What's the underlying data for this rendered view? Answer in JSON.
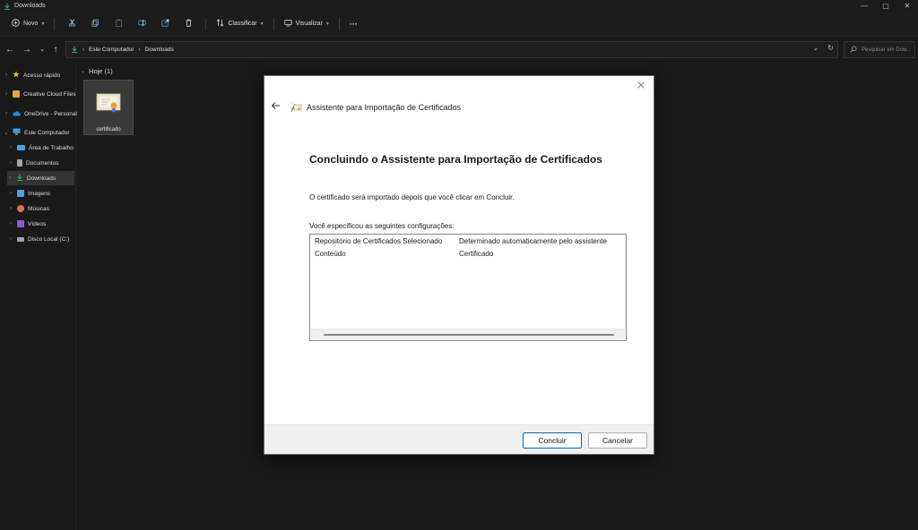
{
  "window": {
    "title": "Downloads",
    "controls": [
      "—",
      "▢",
      "✕"
    ]
  },
  "toolbar": {
    "new_label": "Novo",
    "sort_label": "Classificar",
    "view_label": "Visualizar",
    "more_label": "···"
  },
  "address": {
    "crumbs": [
      "Este Computador",
      "Downloads"
    ],
    "search_placeholder": "Pesquisar em Dow..."
  },
  "sidebar": {
    "items": [
      {
        "label": "Acesso rápido",
        "icon": "star-icon",
        "color": "#f5c518"
      },
      {
        "label": "Creative Cloud Files",
        "icon": "creative-cloud-icon",
        "color": "#e8a33a"
      },
      {
        "label": "OneDrive - Personal",
        "icon": "cloud-icon",
        "color": "#1f8fe0"
      },
      {
        "label": "Este Computador",
        "icon": "computer-icon",
        "color": "#3aa0e8"
      },
      {
        "label": "Área de Trabalho",
        "icon": "desktop-icon",
        "color": "#47a6e0"
      },
      {
        "label": "Documentos",
        "icon": "document-icon",
        "color": "#9ea7b3"
      },
      {
        "label": "Downloads",
        "icon": "download-icon",
        "color": "#34b36f"
      },
      {
        "label": "Imagens",
        "icon": "pictures-icon",
        "color": "#4aa3df"
      },
      {
        "label": "Músicas",
        "icon": "music-icon",
        "color": "#e06b57"
      },
      {
        "label": "Vídeos",
        "icon": "video-icon",
        "color": "#8b5cd6"
      },
      {
        "label": "Disco Local (C:)",
        "icon": "drive-icon",
        "color": "#9aa3ad"
      }
    ]
  },
  "content": {
    "group_label": "Hoje (1)",
    "file_name": "certificado"
  },
  "dialog": {
    "header_title": "Assistente para Importação de Certificados",
    "heading": "Concluindo o Assistente para Importação de Certificados",
    "message": "O certificado será importado depois que você clicar em Concluir.",
    "config_label": "Você especificou as seguintes configurações:",
    "config_rows": [
      {
        "key": "Repositório de Certificados Selecionado",
        "value": "Determinado automaticamente pelo assistente"
      },
      {
        "key": "Conteúdo",
        "value": "Certificado"
      }
    ],
    "finish_label": "Concluir",
    "cancel_label": "Cancelar"
  },
  "colors": {
    "accent": "#0067c0",
    "explorer_bg": "#191919"
  }
}
